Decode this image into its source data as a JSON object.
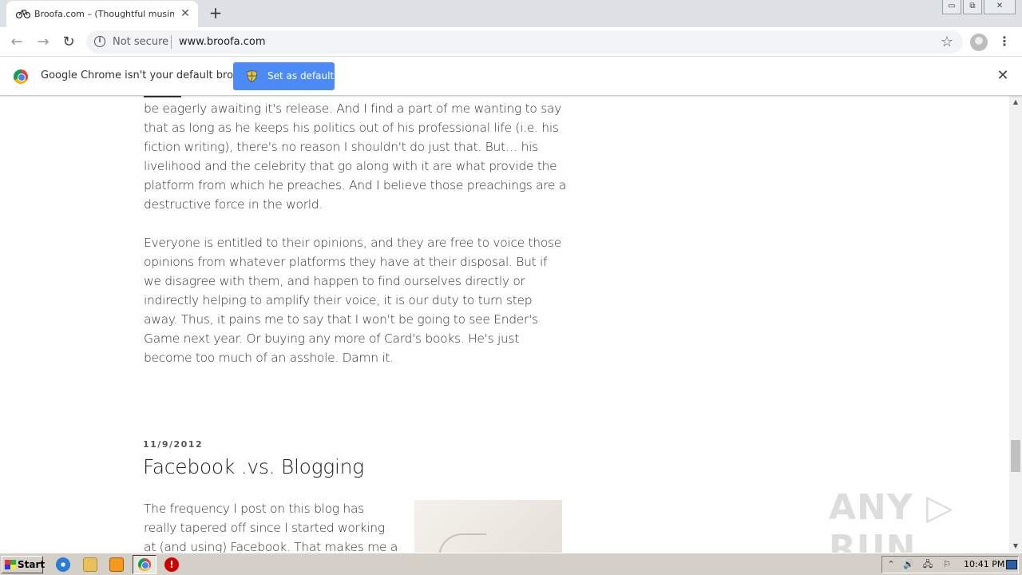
{
  "browser": {
    "tab": {
      "title": "Broofa.com – (Thoughtful musings, I",
      "close": "✕"
    },
    "new_tab": "+",
    "window_buttons": {
      "minimize": "▭",
      "restore": "⧉",
      "close": "✕"
    },
    "address": {
      "security": "Not secure",
      "url": "www.broofa.com"
    },
    "icons": {
      "back": "back-arrow-icon",
      "forward": "forward-arrow-icon",
      "reload": "reload-icon",
      "star": "star-icon",
      "menu": "kebab-menu-icon"
    }
  },
  "infobar": {
    "message": "Google Chrome isn't your default browser",
    "button": "Set as default",
    "close": "✕"
  },
  "page": {
    "paragraph1": "be eagerly awaiting it's release.  And I find a part of me wanting to say that as long as he keeps his politics out of his professional life (i.e. his fiction writing), there's no reason I shouldn't do just that.  But… his livelihood and the celebrity that go along with it are what provide the platform from which he preaches.  And I believe those preachings are a destructive force in the world.",
    "paragraph2": "Everyone is entitled to their opinions, and they are free to voice those opinions from whatever platforms they have at their disposal.  But if we disagree with them, and happen to find ourselves directly or indirectly helping to amplify their voice, it is our duty to turn step away.  Thus, it pains me to say that I won't be going to see Ender's Game next year.  Or buying any more of Card's books.  He's just become too much of an asshole.  Damn it.",
    "post": {
      "date": "11/9/2012",
      "title": "Facebook .vs. Blogging",
      "excerpt": "The frequency I post on this blog has really tapered off since I started working at (and using) Facebook.  That makes me a little"
    },
    "watermark": "ANY ▷ RUN",
    "scroll_position": 0.83
  },
  "taskbar": {
    "start": "Start",
    "stop_icon": "!",
    "tray_icons": [
      "⌃",
      "🔊",
      "🖧",
      "⚐"
    ],
    "clock": "10:41 PM"
  }
}
